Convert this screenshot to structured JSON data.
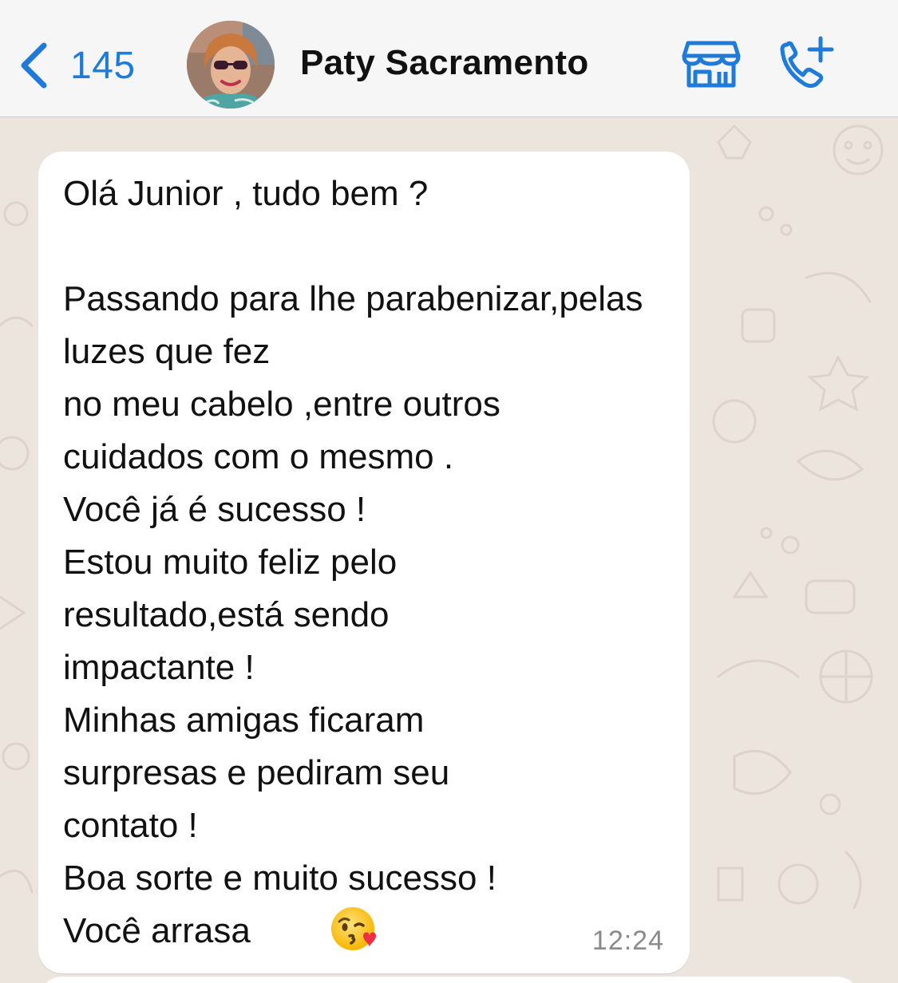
{
  "header": {
    "back_count": "145",
    "contact_name": "Paty Sacramento",
    "icons": {
      "back": "chevron-left-icon",
      "business": "storefront-icon",
      "call": "add-call-icon"
    },
    "accent_color": "#1f7bd9"
  },
  "chat": {
    "background_color": "#ece5dd",
    "messages": [
      {
        "direction": "incoming",
        "text": "Olá Junior , tudo bem ?\n\nPassando para lhe parabenizar,pelas luzes que fez\nno meu cabelo ,entre outros\ncuidados com o mesmo .\nVocê já é sucesso !\nEstou muito feliz pelo\nresultado,está sendo\nimpactante !\nMinhas amigas ficaram\nsurpresas e pediram seu\ncontato !\nBoa sorte e muito sucesso !\nVocê arrasa",
        "emoji": "face-blowing-a-kiss",
        "time": "12:24"
      }
    ]
  }
}
